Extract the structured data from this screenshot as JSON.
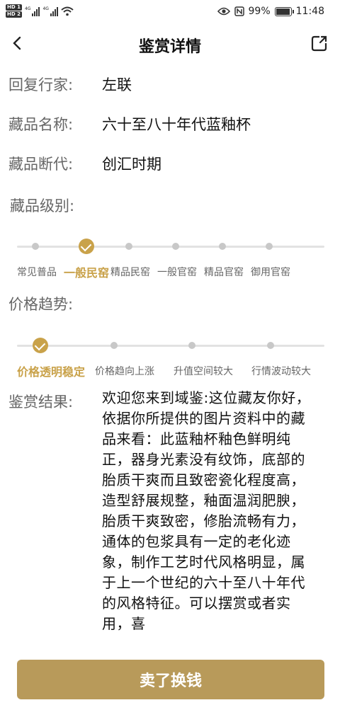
{
  "status_bar": {
    "hd1": "HD 1",
    "hd2": "HD 2",
    "net1": "4G",
    "net2": "4G",
    "battery": "99%",
    "time": "11:48"
  },
  "header": {
    "title": "鉴赏详情"
  },
  "fields": {
    "expert_label": "回复行家:",
    "expert_value": "左联",
    "name_label": "藏品名称:",
    "name_value": "六十至八十年代蓝釉杯",
    "era_label": "藏品断代:",
    "era_value": "创汇时期",
    "level_label": "藏品级别:",
    "trend_label": "价格趋势:",
    "result_label": "鉴赏结果:"
  },
  "levels": {
    "options": [
      "常见普品",
      "一般民窑",
      "精品民窑",
      "一般官窑",
      "精品官窑",
      "御用官窑"
    ],
    "selected_index": 1
  },
  "trends": {
    "options": [
      "价格透明稳定",
      "价格趋向上涨",
      "升值空间较大",
      "行情波动较大"
    ],
    "selected_index": 0
  },
  "result_text": "欢迎您来到域鉴:这位藏友你好，依据你所提供的图片资料中的藏品来看：此蓝釉杯釉色鲜明纯正，器身光素没有纹饰，底部的胎质干爽而且致密瓷化程度高，造型舒展规整，釉面温润肥腴，胎质干爽致密，修胎流畅有力，通体的包浆具有一定的老化迹象，制作工艺时代风格明显，属于上一个世纪的六十至八十年代的风格特征。可以摆赏或者实用，喜",
  "sell_button": "卖了换钱",
  "colors": {
    "accent": "#c9a24a",
    "button": "#b89a5a"
  }
}
